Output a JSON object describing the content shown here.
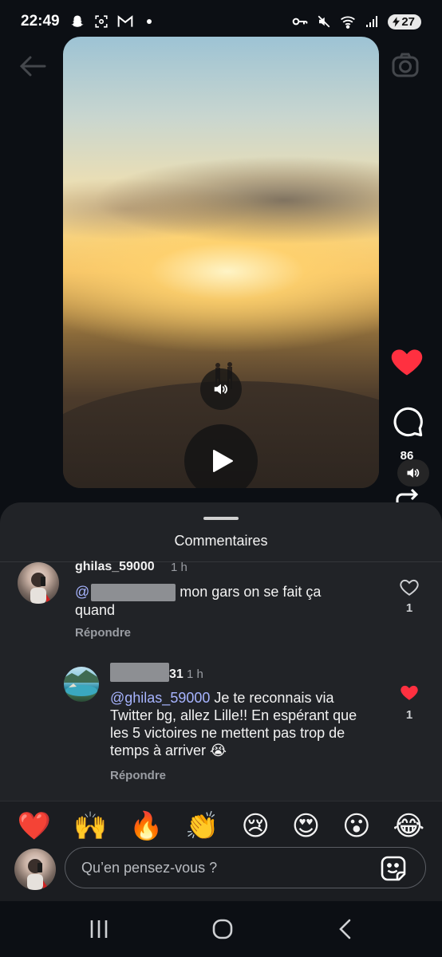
{
  "status": {
    "time": "22:49",
    "battery": "27",
    "left_icons": [
      "snapchat-icon",
      "screenshot-icon",
      "gmail-icon",
      "dot-icon"
    ],
    "right_icons": [
      "key-icon",
      "mute-icon",
      "wifi-icon",
      "signal-icon"
    ]
  },
  "video": {
    "comment_count": "86"
  },
  "comments_sheet": {
    "title": "Commentaires",
    "comments": [
      {
        "username": "ghilas_59000",
        "time": "1 h",
        "mention": "@",
        "text": " mon gars on se fait ça quand",
        "reply_label": "Répondre",
        "like_count": "1",
        "liked": false
      },
      {
        "username_suffix": "31",
        "time": "1 h",
        "mention": "@ghilas_59000",
        "text": " Je te reconnais via Twitter bg, allez Lille!! En espérant que les 5 victoires ne mettent pas trop de temps à arriver 😭",
        "reply_label": "Répondre",
        "like_count": "1",
        "liked": true
      }
    ]
  },
  "emoji_bar": [
    "❤️",
    "🙌",
    "🔥",
    "👏",
    "😢",
    "😍",
    "😮",
    "😂"
  ],
  "composer": {
    "placeholder": "Qu’en pensez-vous ?"
  },
  "colors": {
    "like_red": "#ff3040",
    "mention_blue": "#a7b4ff",
    "sheet_bg": "#212327"
  }
}
